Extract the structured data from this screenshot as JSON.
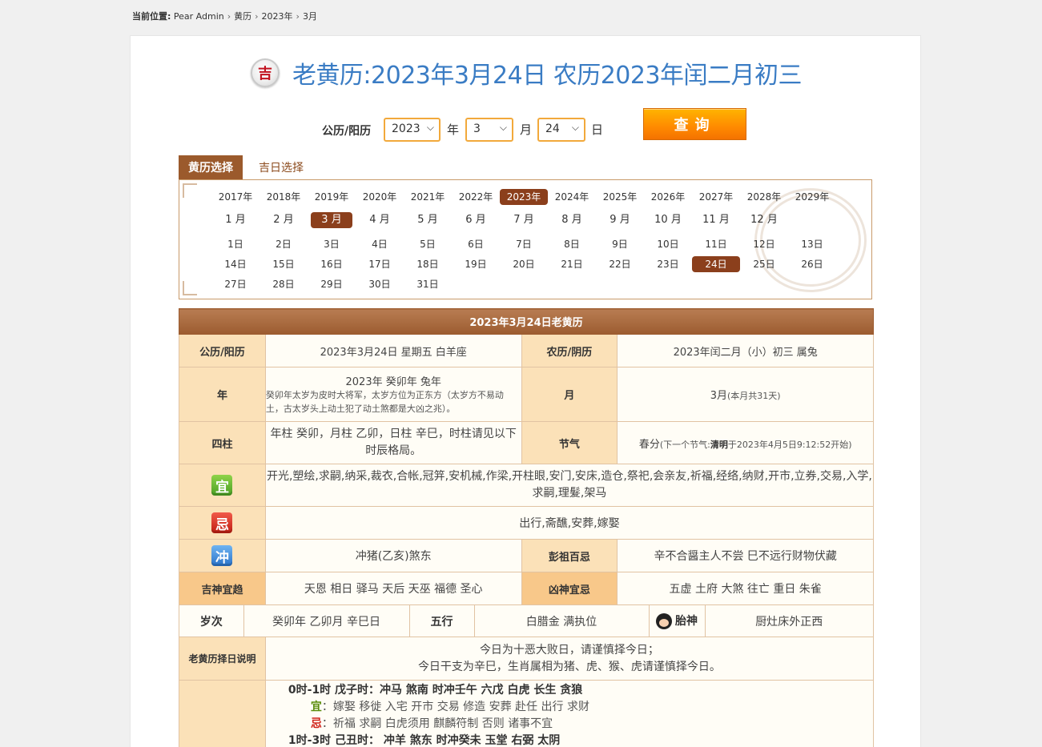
{
  "breadcrumb": {
    "label": "当前位置:",
    "items": [
      "Pear Admin",
      "黄历",
      "2023年",
      "3月"
    ]
  },
  "title": {
    "icon_char": "吉",
    "text": "老黄历:2023年3月24日 农历2023年闰二月初三"
  },
  "query": {
    "label": "公历/阳历",
    "year": "2023",
    "year_unit": "年",
    "month": "3",
    "month_unit": "月",
    "day": "24",
    "day_unit": "日",
    "button": "查询"
  },
  "tabs": [
    {
      "label": "黄历选择",
      "active": true
    },
    {
      "label": "吉日选择",
      "active": false
    }
  ],
  "picker": {
    "years": [
      "2017年",
      "2018年",
      "2019年",
      "2020年",
      "2021年",
      "2022年",
      "2023年",
      "2024年",
      "2025年",
      "2026年",
      "2027年",
      "2028年",
      "2029年"
    ],
    "selected_year": "2023年",
    "months": [
      "1 月",
      "2 月",
      "3 月",
      "4 月",
      "5 月",
      "6 月",
      "7 月",
      "8 月",
      "9 月",
      "10 月",
      "11 月",
      "12 月"
    ],
    "selected_month": "3 月",
    "days": [
      "1日",
      "2日",
      "3日",
      "4日",
      "5日",
      "6日",
      "7日",
      "8日",
      "9日",
      "10日",
      "11日",
      "12日",
      "13日",
      "14日",
      "15日",
      "16日",
      "17日",
      "18日",
      "19日",
      "20日",
      "21日",
      "22日",
      "23日",
      "24日",
      "25日",
      "26日",
      "27日",
      "28日",
      "29日",
      "30日",
      "31日"
    ],
    "selected_day": "24日"
  },
  "almanac": {
    "header": "2023年3月24日老黄历",
    "solar_label": "公历/阳历",
    "solar_value": "2023年3月24日  星期五  白羊座",
    "lunar_label": "农历/阴历",
    "lunar_value": "2023年闰二月（小）初三  属兔",
    "year_label": "年",
    "year_main": "2023年  癸卯年  兔年",
    "year_note": "癸卯年太岁为皮时大将军，太岁方位为正东方（太岁方不易动土，古太岁头上动土犯了动土煞都是大凶之兆）。",
    "month_label": "月",
    "month_main": "3月",
    "month_note": "(本月共31天)",
    "pillars_label": "四柱",
    "pillars_value": "年柱  癸卯，月柱  乙卯，日柱  辛巳，时柱请见以下时辰格局。",
    "jieqi_label": "节气",
    "jieqi_main": "春分",
    "jieqi_note_prefix": "(下一个节气:",
    "jieqi_note_name": "清明",
    "jieqi_note_suffix": "于2023年4月5日9:12:52开始)",
    "yi_badge": "宜",
    "yi_value": "开光,塑绘,求嗣,纳采,裁衣,合帐,冠笄,安机械,作梁,开柱眼,安门,安床,造仓,祭祀,会亲友,祈福,经络,纳财,开市,立券,交易,入学,求嗣,理髮,架马",
    "ji_badge": "忌",
    "ji_value": "出行,斋醮,安葬,嫁娶",
    "chong_badge": "冲",
    "chong_value": "冲猪(乙亥)煞东",
    "pengzu_label": "彭祖百忌",
    "pengzu_value": "辛不合醤主人不尝  巳不远行财物伏藏",
    "jishen_label": "吉神宜趋",
    "jishen_value": "天恩  相日  驿马  天后  天巫  福德  圣心",
    "xiongshen_label": "凶神宜忌",
    "xiongshen_value": "五虚  土府  大煞  往亡  重日  朱雀",
    "suici_label": "岁次",
    "suici_value": "癸卯年  乙卯月  辛巳日",
    "wuxing_label": "五行",
    "wuxing_value": "白腊金  满执位",
    "taishen_label": "胎神",
    "taishen_value": "厨灶床外正西",
    "explain_label": "老黄历择日说明",
    "explain_line1": "今日为十恶大败日，请谨慎择今日；",
    "explain_line2": "今日干支为辛巳，生肖属相为猪、虎、猴、虎请谨慎择今日。",
    "hours": [
      {
        "main": "0时-1时  戊子时：冲马  煞南  时冲壬午  六戊  白虎  长生  贪狼",
        "yi": "嫁娶  移徙  入宅  开市  交易  修造  安葬  赴任  出行  求财",
        "ji": "祈福  求嗣  白虎须用  麒麟符制  否则  诸事不宜"
      },
      {
        "main": "1时-3时  己丑时：  冲羊  煞东  时冲癸未  玉堂  右弼  太阴"
      }
    ],
    "yi_short": "宜",
    "ji_short": "忌"
  },
  "colors": {
    "accent_brown": "#9b5a2c",
    "title_blue": "#3a7cc4",
    "yi_green": "#5b8d0d",
    "ji_red": "#d0241a",
    "query_orange": "#ff8a00"
  }
}
